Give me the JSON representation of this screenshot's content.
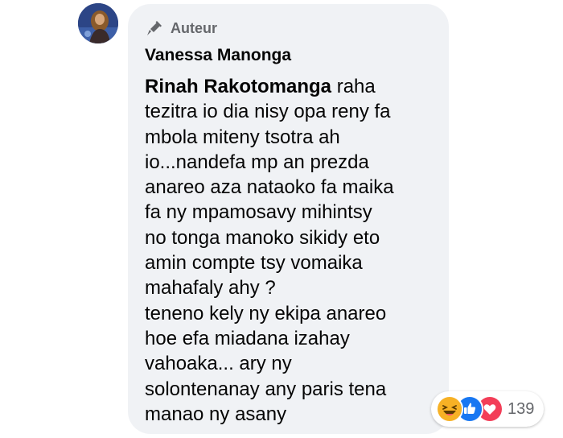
{
  "comment": {
    "badge_label": "Auteur",
    "badge_icon": "megaphone-icon",
    "author_name": "Vanessa Manonga",
    "mention": "Rinah Rakotomanga",
    "body_first": " raha",
    "body_lines": [
      "tezitra io dia nisy opa reny fa",
      "mbola miteny tsotra ah",
      "io...nandefa mp an prezda",
      "anareo aza nataoko fa maika",
      "fa ny mpamosavy mihintsy",
      "no tonga manoko sikidy eto",
      "amin compte tsy vomaika",
      "mahafaly ahy ?",
      "teneno kely ny ekipa anareo",
      "hoe efa miadana izahay",
      "vahoaka... ary ny",
      "solontenanay any paris tena",
      "manao ny asany"
    ]
  },
  "reactions": {
    "icons": [
      "haha-icon",
      "like-icon",
      "love-icon"
    ],
    "count": "139"
  },
  "colors": {
    "bubble": "#f0f2f5",
    "secondary_text": "#65676b",
    "like": "#1877f2",
    "love": "#f33e58",
    "haha": "#f7b125"
  }
}
